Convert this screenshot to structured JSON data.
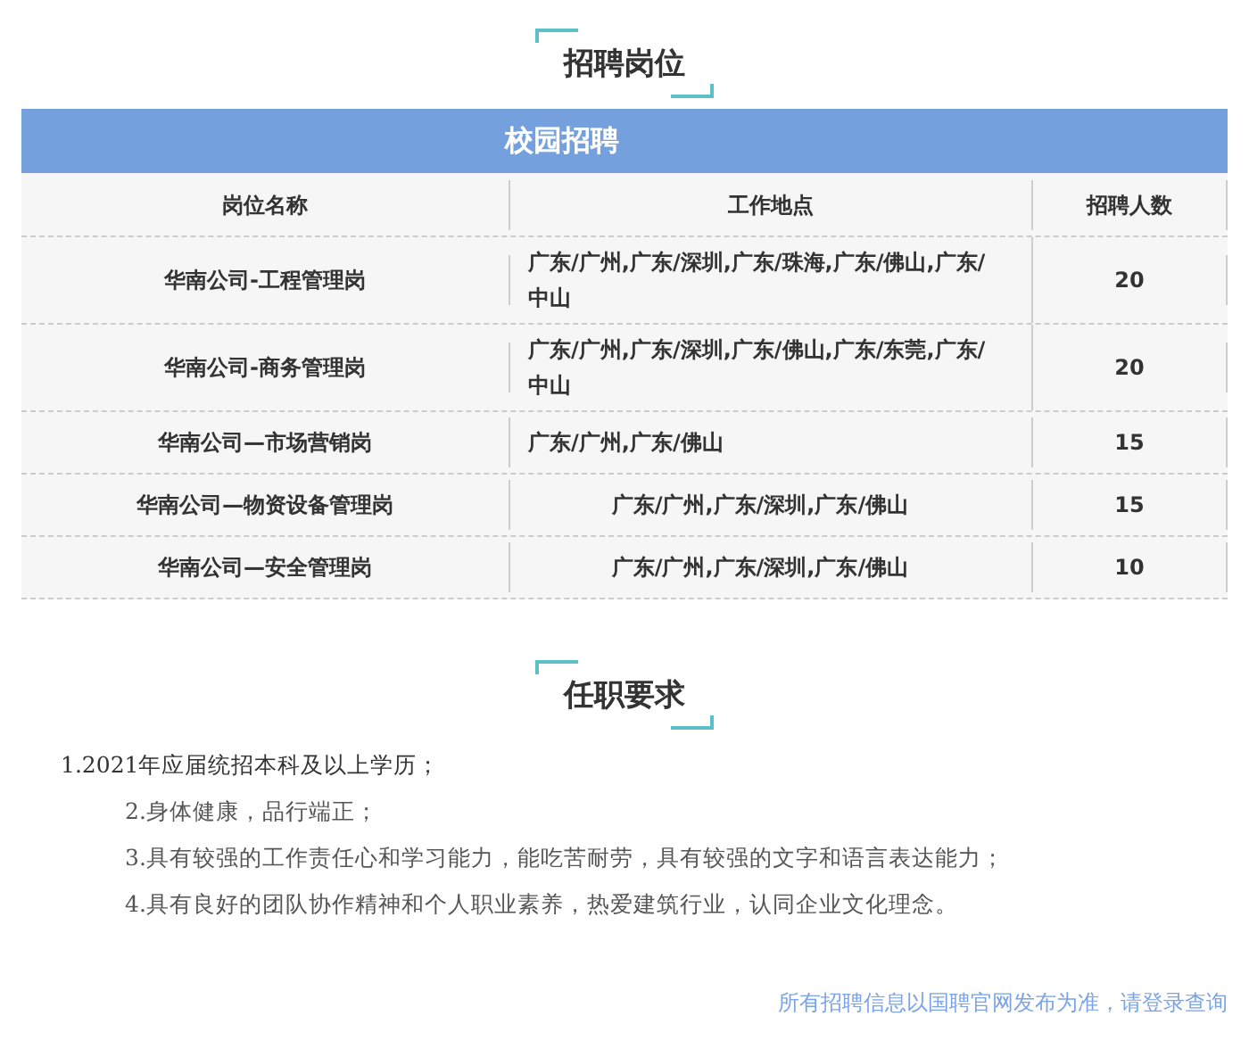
{
  "section_1": {
    "heading": "招聘岗位"
  },
  "table": {
    "title": "校园招聘",
    "columns": [
      "岗位名称",
      "工作地点",
      "招聘人数"
    ],
    "rows": [
      {
        "cells": [
          "华南公司-工程管理岗",
          "广东/广州,广东/深圳,广东/珠海,广东/佛山,广东/中山",
          "20"
        ],
        "location_centered": false
      },
      {
        "cells": [
          "华南公司-商务管理岗",
          "广东/广州,广东/深圳,广东/佛山,广东/东莞,广东/中山",
          "20"
        ],
        "location_centered": false
      },
      {
        "cells": [
          "华南公司—市场营销岗",
          "广东/广州,广东/佛山",
          "15"
        ],
        "location_centered": false
      },
      {
        "cells": [
          "华南公司—物资设备管理岗",
          "广东/广州,广东/深圳,广东/佛山",
          "15"
        ],
        "location_centered": true
      },
      {
        "cells": [
          "华南公司—安全管理岗",
          "广东/广州,广东/深圳,广东/佛山",
          "10"
        ],
        "location_centered": true
      }
    ]
  },
  "section_2": {
    "heading": "任职要求"
  },
  "requirements": [
    {
      "text": "1.2021年应届统招本科及以上学历；",
      "children": [
        {
          "text": "2.身体健康，品行端正；"
        },
        {
          "text": "3.具有较强的工作责任心和学习能力，能吃苦耐劳，具有较强的文字和语言表达能力；"
        },
        {
          "text": "4.具有良好的团队协作精神和个人职业素养，热爱建筑行业，认同企业文化理念。"
        }
      ]
    }
  ],
  "footer": "所有招聘信息以国聘官网发布为准，请登录查询"
}
